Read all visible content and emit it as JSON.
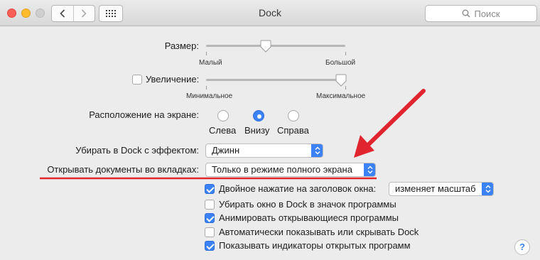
{
  "window": {
    "title": "Dock"
  },
  "toolbar": {
    "search_placeholder": "Поиск"
  },
  "size": {
    "label": "Размер:",
    "min_label": "Малый",
    "max_label": "Большой",
    "value_fraction": 0.43
  },
  "magnification": {
    "label": "Увеличение:",
    "checked": false,
    "min_label": "Минимальное",
    "max_label": "Максимальное",
    "value_fraction": 0.96
  },
  "position": {
    "label": "Расположение на экране:",
    "options": [
      {
        "label": "Слева",
        "selected": false
      },
      {
        "label": "Внизу",
        "selected": true
      },
      {
        "label": "Справа",
        "selected": false
      }
    ]
  },
  "minimize_effect": {
    "label": "Убирать в Dock с эффектом:",
    "value": "Джинн"
  },
  "open_documents": {
    "label": "Открывать документы во вкладках:",
    "value": "Только в режиме полного экрана"
  },
  "checkboxes": [
    {
      "label": "Двойное нажатие на заголовок окна:",
      "checked": true
    },
    {
      "label": "Убирать окно в Dock в значок программы",
      "checked": false
    },
    {
      "label": "Анимировать открывающиеся программы",
      "checked": true
    },
    {
      "label": "Автоматически показывать или скрывать Dock",
      "checked": false
    },
    {
      "label": "Показывать индикаторы открытых программ",
      "checked": true
    }
  ],
  "double_click_action": {
    "value": "изменяет масштаб"
  },
  "help": {
    "label": "?"
  },
  "colors": {
    "accent": "#3b82f6",
    "annotation": "#e0252e"
  }
}
